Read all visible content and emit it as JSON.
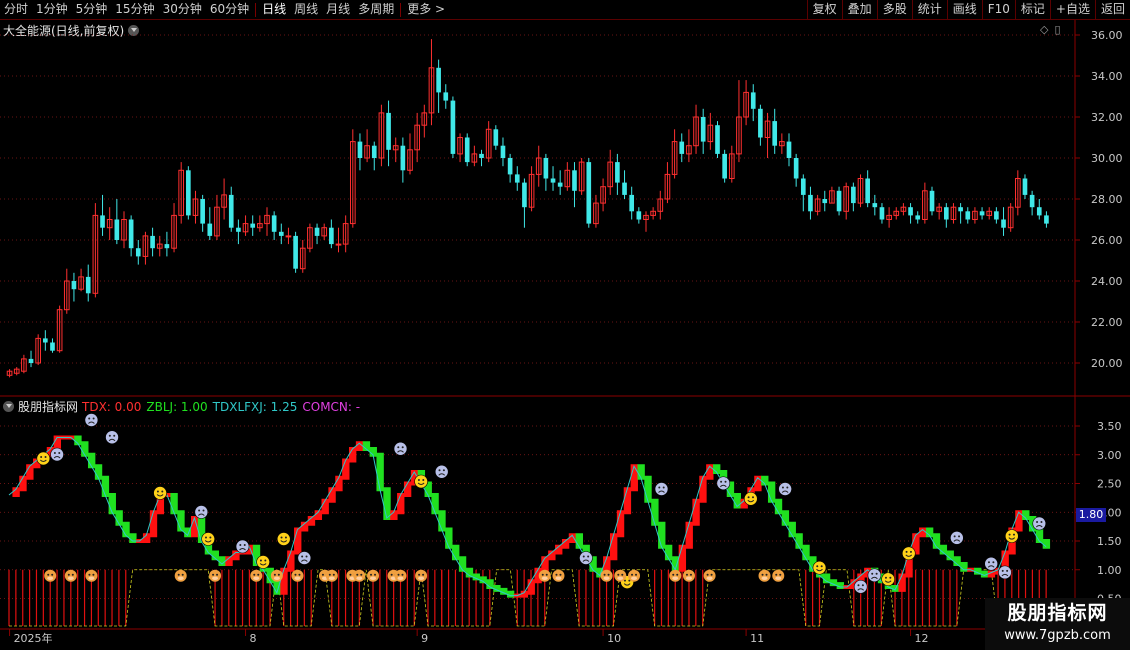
{
  "toolbar": {
    "periods": [
      "分时",
      "1分钟",
      "5分钟",
      "15分钟",
      "30分钟",
      "60分钟",
      "日线",
      "周线",
      "月线",
      "多周期",
      "更多 >"
    ],
    "active_period": "日线",
    "actions": [
      "复权",
      "叠加",
      "多股",
      "统计",
      "画线",
      "F10",
      "标记",
      "+自选",
      "返回"
    ]
  },
  "main_chart": {
    "title": "大全能源(日线,前复权)",
    "y_ticks": [
      "36.00",
      "34.00",
      "32.00",
      "30.00",
      "28.00",
      "26.00",
      "24.00",
      "22.00",
      "20.00"
    ],
    "candles": [
      [
        19.4,
        19.6,
        19.3,
        19.7
      ],
      [
        19.5,
        19.7,
        19.4,
        19.8
      ],
      [
        19.6,
        20.2,
        19.5,
        20.4
      ],
      [
        20.2,
        20.0,
        19.8,
        20.6
      ],
      [
        20.0,
        21.2,
        19.9,
        21.4
      ],
      [
        21.2,
        21.0,
        20.6,
        21.6
      ],
      [
        21.0,
        20.6,
        20.5,
        21.2
      ],
      [
        20.6,
        22.6,
        20.5,
        22.8
      ],
      [
        22.6,
        24.0,
        22.4,
        24.6
      ],
      [
        24.0,
        23.6,
        23.0,
        24.4
      ],
      [
        23.6,
        24.2,
        23.5,
        24.6
      ],
      [
        24.2,
        23.4,
        23.0,
        24.8
      ],
      [
        23.4,
        27.2,
        23.2,
        27.8
      ],
      [
        27.2,
        26.6,
        26.2,
        28.2
      ],
      [
        26.6,
        27.0,
        26.0,
        27.6
      ],
      [
        27.0,
        26.0,
        25.8,
        28.0
      ],
      [
        26.0,
        27.0,
        25.6,
        27.4
      ],
      [
        27.0,
        25.6,
        25.2,
        27.2
      ],
      [
        25.6,
        25.2,
        24.8,
        26.0
      ],
      [
        25.2,
        26.2,
        24.8,
        26.4
      ],
      [
        26.2,
        25.6,
        25.2,
        26.6
      ],
      [
        25.6,
        25.8,
        25.2,
        26.2
      ],
      [
        25.8,
        25.6,
        25.2,
        26.4
      ],
      [
        25.6,
        27.2,
        25.4,
        27.8
      ],
      [
        27.2,
        29.4,
        26.8,
        29.8
      ],
      [
        29.4,
        27.2,
        27.0,
        29.6
      ],
      [
        27.2,
        28.0,
        26.8,
        28.4
      ],
      [
        28.0,
        26.8,
        26.4,
        28.2
      ],
      [
        26.8,
        26.2,
        26.0,
        27.6
      ],
      [
        26.2,
        27.6,
        26.0,
        28.2
      ],
      [
        27.6,
        28.2,
        27.0,
        29.0
      ],
      [
        28.2,
        26.6,
        26.4,
        28.6
      ],
      [
        26.6,
        26.4,
        25.8,
        27.0
      ],
      [
        26.4,
        26.8,
        26.2,
        27.2
      ],
      [
        26.8,
        26.6,
        26.2,
        27.2
      ],
      [
        26.6,
        26.8,
        26.4,
        27.2
      ],
      [
        26.8,
        27.2,
        26.2,
        27.6
      ],
      [
        27.2,
        26.4,
        26.0,
        27.4
      ],
      [
        26.4,
        26.2,
        25.8,
        26.8
      ],
      [
        26.2,
        26.2,
        25.8,
        26.6
      ],
      [
        26.2,
        24.6,
        24.4,
        26.4
      ],
      [
        24.6,
        25.6,
        24.4,
        26.0
      ],
      [
        25.6,
        26.6,
        25.4,
        26.8
      ],
      [
        26.6,
        26.2,
        25.8,
        26.8
      ],
      [
        26.2,
        26.6,
        26.0,
        26.8
      ],
      [
        26.6,
        25.8,
        25.6,
        27.0
      ],
      [
        25.8,
        25.8,
        25.4,
        26.6
      ],
      [
        25.8,
        26.8,
        25.4,
        27.2
      ],
      [
        26.8,
        30.8,
        26.6,
        31.4
      ],
      [
        30.8,
        30.0,
        29.4,
        31.2
      ],
      [
        30.0,
        30.6,
        29.8,
        31.4
      ],
      [
        30.6,
        30.0,
        29.4,
        30.8
      ],
      [
        30.0,
        32.2,
        29.6,
        32.6
      ],
      [
        32.2,
        30.4,
        29.6,
        32.8
      ],
      [
        30.4,
        30.6,
        29.8,
        31.0
      ],
      [
        30.6,
        29.4,
        28.8,
        31.0
      ],
      [
        29.4,
        30.4,
        29.2,
        31.2
      ],
      [
        30.4,
        31.6,
        29.8,
        32.2
      ],
      [
        31.6,
        32.2,
        31.0,
        32.6
      ],
      [
        32.2,
        34.4,
        31.6,
        35.8
      ],
      [
        34.4,
        33.2,
        32.2,
        34.8
      ],
      [
        33.2,
        32.8,
        32.4,
        33.6
      ],
      [
        32.8,
        30.2,
        30.0,
        33.0
      ],
      [
        30.2,
        31.0,
        29.8,
        31.2
      ],
      [
        31.0,
        29.8,
        29.6,
        31.2
      ],
      [
        29.8,
        30.2,
        29.6,
        30.6
      ],
      [
        30.2,
        30.0,
        29.6,
        30.4
      ],
      [
        30.0,
        31.4,
        29.8,
        31.8
      ],
      [
        31.4,
        30.6,
        30.4,
        31.6
      ],
      [
        30.6,
        30.0,
        29.6,
        31.0
      ],
      [
        30.0,
        29.2,
        28.8,
        30.2
      ],
      [
        29.2,
        28.8,
        28.4,
        29.6
      ],
      [
        28.8,
        27.6,
        26.6,
        29.0
      ],
      [
        27.6,
        29.2,
        27.4,
        29.6
      ],
      [
        29.2,
        30.0,
        28.6,
        30.6
      ],
      [
        30.0,
        29.0,
        28.4,
        30.2
      ],
      [
        29.0,
        28.8,
        28.4,
        29.6
      ],
      [
        28.8,
        28.6,
        28.2,
        29.4
      ],
      [
        28.6,
        29.4,
        28.4,
        29.8
      ],
      [
        29.4,
        28.4,
        27.6,
        29.8
      ],
      [
        28.4,
        29.8,
        28.2,
        30.0
      ],
      [
        29.8,
        26.8,
        26.6,
        30.0
      ],
      [
        26.8,
        27.8,
        26.6,
        28.2
      ],
      [
        27.8,
        28.6,
        27.4,
        29.0
      ],
      [
        28.6,
        29.8,
        28.2,
        30.4
      ],
      [
        29.8,
        28.8,
        28.2,
        30.2
      ],
      [
        28.8,
        28.2,
        28.0,
        29.4
      ],
      [
        28.2,
        27.4,
        27.0,
        28.6
      ],
      [
        27.4,
        27.0,
        26.8,
        27.6
      ],
      [
        27.0,
        27.2,
        26.4,
        27.4
      ],
      [
        27.2,
        27.4,
        27.0,
        27.6
      ],
      [
        27.4,
        28.0,
        27.0,
        28.4
      ],
      [
        28.0,
        29.2,
        27.8,
        29.8
      ],
      [
        29.2,
        30.8,
        29.0,
        31.4
      ],
      [
        30.8,
        30.2,
        29.8,
        31.2
      ],
      [
        30.2,
        30.6,
        29.8,
        31.4
      ],
      [
        30.6,
        32.0,
        30.2,
        32.6
      ],
      [
        32.0,
        30.8,
        30.2,
        32.4
      ],
      [
        30.8,
        31.6,
        30.4,
        32.2
      ],
      [
        31.6,
        30.2,
        30.0,
        31.8
      ],
      [
        30.2,
        29.0,
        28.8,
        30.4
      ],
      [
        29.0,
        30.2,
        28.8,
        30.6
      ],
      [
        30.2,
        32.0,
        29.8,
        33.8
      ],
      [
        32.0,
        33.2,
        31.6,
        33.8
      ],
      [
        33.2,
        32.4,
        31.8,
        33.6
      ],
      [
        32.4,
        31.0,
        30.6,
        32.6
      ],
      [
        31.0,
        31.8,
        30.0,
        32.2
      ],
      [
        31.8,
        30.6,
        30.2,
        32.4
      ],
      [
        30.6,
        30.8,
        30.2,
        31.2
      ],
      [
        30.8,
        30.0,
        29.6,
        31.2
      ],
      [
        30.0,
        29.0,
        28.6,
        30.2
      ],
      [
        29.0,
        28.2,
        27.4,
        29.2
      ],
      [
        28.2,
        27.4,
        27.0,
        28.6
      ],
      [
        27.4,
        28.0,
        27.2,
        28.2
      ],
      [
        28.0,
        27.8,
        27.4,
        28.4
      ],
      [
        27.8,
        28.4,
        27.8,
        28.6
      ],
      [
        28.4,
        27.4,
        27.2,
        28.6
      ],
      [
        27.4,
        28.6,
        27.0,
        28.8
      ],
      [
        28.6,
        27.8,
        27.4,
        28.8
      ],
      [
        27.8,
        29.0,
        27.6,
        29.2
      ],
      [
        29.0,
        27.8,
        27.6,
        29.4
      ],
      [
        27.8,
        27.6,
        27.2,
        28.2
      ],
      [
        27.6,
        27.0,
        26.8,
        27.8
      ],
      [
        27.0,
        27.2,
        26.6,
        27.6
      ],
      [
        27.2,
        27.4,
        27.0,
        27.6
      ],
      [
        27.4,
        27.6,
        27.2,
        27.8
      ],
      [
        27.6,
        27.2,
        26.8,
        27.8
      ],
      [
        27.2,
        27.0,
        26.8,
        27.4
      ],
      [
        27.0,
        28.4,
        26.8,
        28.8
      ],
      [
        28.4,
        27.4,
        27.2,
        28.6
      ],
      [
        27.4,
        27.6,
        27.0,
        27.8
      ],
      [
        27.6,
        27.0,
        26.6,
        27.8
      ],
      [
        27.0,
        27.6,
        26.8,
        27.8
      ],
      [
        27.6,
        27.4,
        26.8,
        27.8
      ],
      [
        27.4,
        27.0,
        26.8,
        27.6
      ],
      [
        27.0,
        27.4,
        26.8,
        27.6
      ],
      [
        27.4,
        27.2,
        27.0,
        27.6
      ],
      [
        27.2,
        27.4,
        27.0,
        27.6
      ],
      [
        27.4,
        27.0,
        26.8,
        27.6
      ],
      [
        27.0,
        26.6,
        26.2,
        27.6
      ],
      [
        26.6,
        27.6,
        26.4,
        27.8
      ],
      [
        27.6,
        29.0,
        27.2,
        29.4
      ],
      [
        29.0,
        28.2,
        28.0,
        29.2
      ],
      [
        28.2,
        27.6,
        27.2,
        28.4
      ],
      [
        27.6,
        27.2,
        27.0,
        28.0
      ],
      [
        27.2,
        26.8,
        26.6,
        27.4
      ]
    ]
  },
  "indicator": {
    "name": "股朋指标网",
    "legend": [
      {
        "label": "TDX: 0.00",
        "color": "#ff3030"
      },
      {
        "label": "ZBLJ: 1.00",
        "color": "#20e020"
      },
      {
        "label": "TDXLFXJ: 1.25",
        "color": "#30c8c8"
      },
      {
        "label": "COMCN: -",
        "color": "#e040e0"
      }
    ],
    "y_ticks": [
      "3.50",
      "3.00",
      "2.50",
      "2.00",
      "1.50",
      "1.00",
      "0.50"
    ],
    "current_value": "1.80",
    "line": [
      2.3,
      2.4,
      2.6,
      2.8,
      2.9,
      3.0,
      3.1,
      3.3,
      3.3,
      3.3,
      3.2,
      3.0,
      2.8,
      2.6,
      2.3,
      2.0,
      1.8,
      1.6,
      1.5,
      1.5,
      1.6,
      2.0,
      2.3,
      2.3,
      2.0,
      1.7,
      1.6,
      1.9,
      1.5,
      1.3,
      1.2,
      1.1,
      1.2,
      1.3,
      1.3,
      1.4,
      1.1,
      1.0,
      0.8,
      0.6,
      1.0,
      1.3,
      1.7,
      1.8,
      1.9,
      2.0,
      2.2,
      2.4,
      2.6,
      2.9,
      3.1,
      3.2,
      3.1,
      3.0,
      2.4,
      1.9,
      2.0,
      2.3,
      2.5,
      2.7,
      2.5,
      2.3,
      2.0,
      1.7,
      1.4,
      1.2,
      1.0,
      0.9,
      0.85,
      0.8,
      0.7,
      0.65,
      0.6,
      0.55,
      0.55,
      0.6,
      0.8,
      1.0,
      1.2,
      1.3,
      1.4,
      1.5,
      1.6,
      1.4,
      1.2,
      1.0,
      0.9,
      1.2,
      1.6,
      2.0,
      2.4,
      2.8,
      2.6,
      2.2,
      1.8,
      1.4,
      1.2,
      1.0,
      1.4,
      1.8,
      2.2,
      2.6,
      2.8,
      2.7,
      2.5,
      2.3,
      2.1,
      2.2,
      2.4,
      2.6,
      2.5,
      2.2,
      2.0,
      1.8,
      1.6,
      1.4,
      1.2,
      1.0,
      0.9,
      0.8,
      0.75,
      0.7,
      0.7,
      0.8,
      0.9,
      1.0,
      0.9,
      0.8,
      0.7,
      0.65,
      0.9,
      1.3,
      1.6,
      1.7,
      1.6,
      1.4,
      1.3,
      1.2,
      1.1,
      1.0,
      1.0,
      0.95,
      0.9,
      0.95,
      1.0,
      1.3,
      1.7,
      2.0,
      1.9,
      1.7,
      1.5,
      1.4
    ],
    "bar_columns": [
      [
        0,
        17
      ],
      [
        30,
        38
      ],
      [
        40,
        44
      ],
      [
        47,
        51
      ],
      [
        53,
        59
      ],
      [
        61,
        63
      ],
      [
        63,
        70
      ],
      [
        74,
        78
      ],
      [
        83,
        88
      ],
      [
        94,
        101
      ],
      [
        116,
        118
      ],
      [
        123,
        127
      ],
      [
        129,
        131
      ],
      [
        132,
        138
      ],
      [
        144,
        148
      ],
      [
        149,
        151
      ]
    ],
    "happy_markers": [
      {
        "i": 5,
        "v": 2.9
      },
      {
        "i": 22,
        "v": 2.3
      },
      {
        "i": 29,
        "v": 1.5
      },
      {
        "i": 37,
        "v": 1.1
      },
      {
        "i": 40,
        "v": 1.5
      },
      {
        "i": 60,
        "v": 2.5
      },
      {
        "i": 90,
        "v": 0.75
      },
      {
        "i": 118,
        "v": 1.0
      },
      {
        "i": 128,
        "v": 0.8
      },
      {
        "i": 131,
        "v": 1.25
      },
      {
        "i": 146,
        "v": 1.55
      },
      {
        "i": 108,
        "v": 2.2
      }
    ],
    "sad_markers": [
      {
        "i": 7,
        "v": 2.9
      },
      {
        "i": 12,
        "v": 3.5
      },
      {
        "i": 15,
        "v": 3.2
      },
      {
        "i": 28,
        "v": 1.9
      },
      {
        "i": 34,
        "v": 1.3
      },
      {
        "i": 43,
        "v": 1.1
      },
      {
        "i": 57,
        "v": 3.0
      },
      {
        "i": 63,
        "v": 2.6
      },
      {
        "i": 84,
        "v": 1.1
      },
      {
        "i": 95,
        "v": 2.3
      },
      {
        "i": 104,
        "v": 2.4
      },
      {
        "i": 113,
        "v": 2.3
      },
      {
        "i": 124,
        "v": 0.6
      },
      {
        "i": 126,
        "v": 0.8
      },
      {
        "i": 138,
        "v": 1.45
      },
      {
        "i": 143,
        "v": 1.0
      },
      {
        "i": 145,
        "v": 0.85
      },
      {
        "i": 150,
        "v": 1.7
      }
    ],
    "cow_markers": [
      6,
      9,
      12,
      25,
      30,
      36,
      39,
      42,
      46,
      47,
      50,
      51,
      53,
      56,
      57,
      60,
      78,
      80,
      87,
      89,
      91,
      97,
      99,
      102,
      110,
      112
    ]
  },
  "x_axis": {
    "labels": [
      {
        "text": "2025年",
        "i": 0
      },
      {
        "text": "8",
        "i": 33
      },
      {
        "text": "9",
        "i": 57
      },
      {
        "text": "10",
        "i": 83
      },
      {
        "text": "11",
        "i": 103
      },
      {
        "text": "12",
        "i": 126
      }
    ]
  },
  "watermark": {
    "title": "股朋指标网",
    "url": "www.7gpzb.com"
  },
  "colors": {
    "up": "#ff3030",
    "down": "#40e8e8",
    "grid": "#8b1a1a",
    "ind_up": "#ff1010",
    "ind_down": "#20e020"
  }
}
